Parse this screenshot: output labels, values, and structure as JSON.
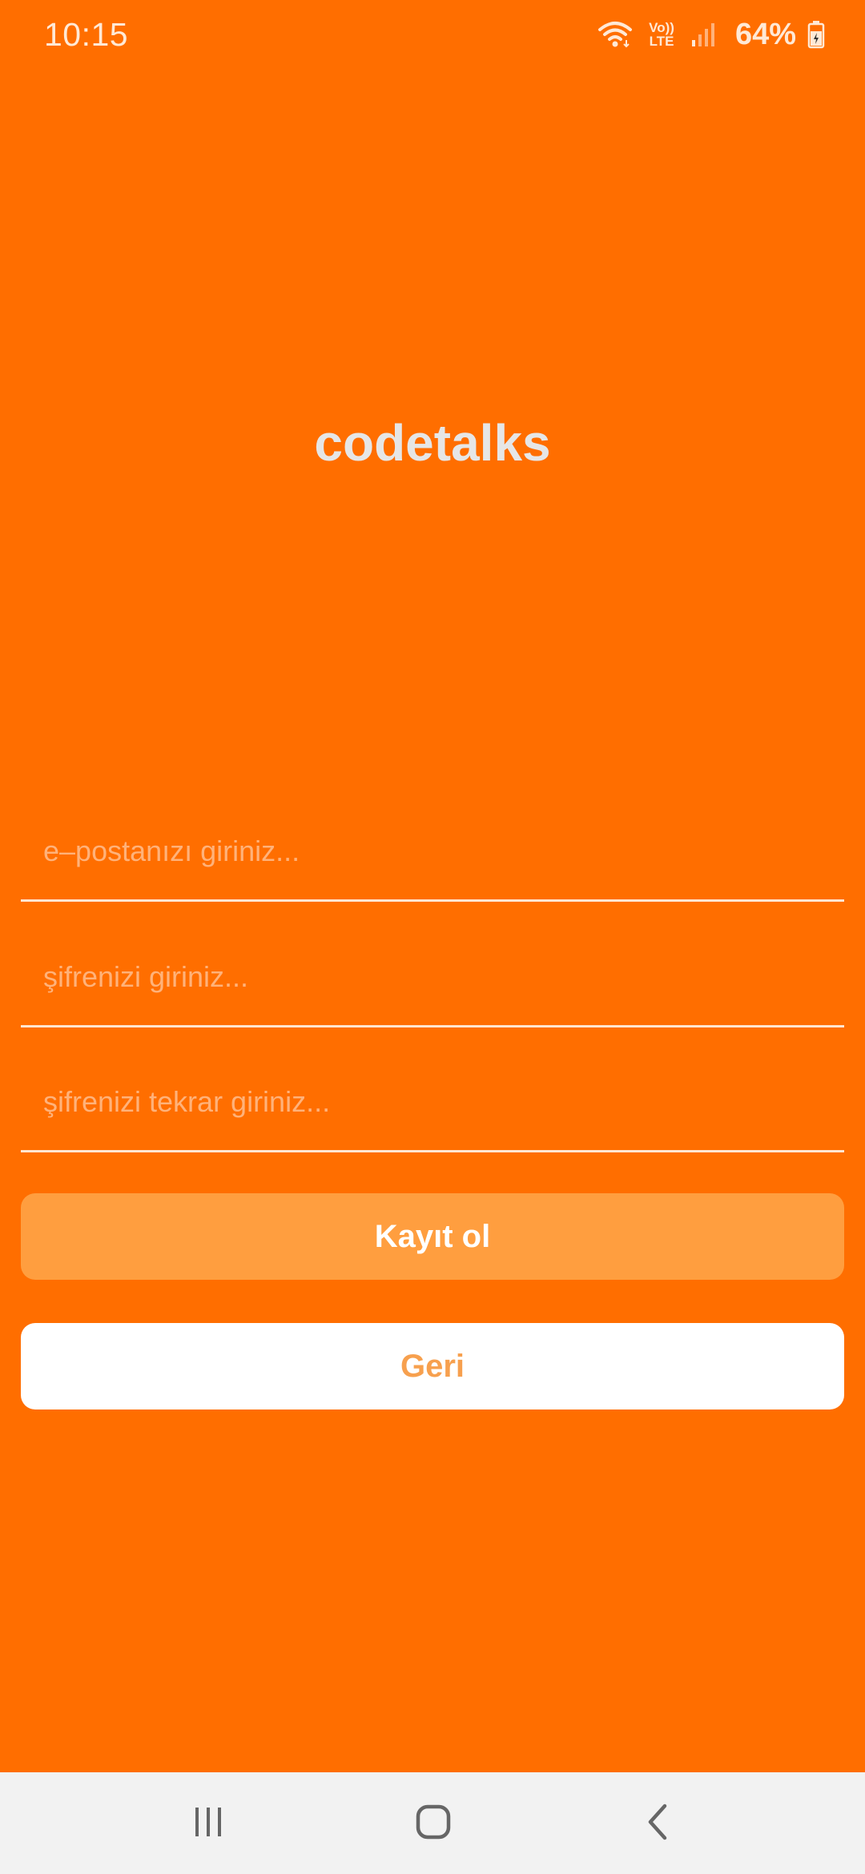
{
  "status_bar": {
    "time": "10:15",
    "volte_top": "Vo))",
    "volte_bottom": "LTE",
    "battery_percent": "64%",
    "icons": [
      "wifi-icon",
      "volte-icon",
      "signal-icon",
      "battery-icon"
    ]
  },
  "app": {
    "title": "codetalks"
  },
  "form": {
    "email_placeholder": "e–postanızı giriniz...",
    "password_placeholder": "şifrenizi giriniz...",
    "password_repeat_placeholder": "şifrenizi tekrar giriniz...",
    "register_label": "Kayıt ol",
    "back_label": "Geri"
  },
  "nav_bar": {
    "icons": [
      "recents-icon",
      "home-icon",
      "back-icon"
    ]
  },
  "colors": {
    "background": "#FF6E00",
    "register_button": "#FF9E3F",
    "back_button": "#FFFFFF",
    "back_button_text": "#F7A04E",
    "title": "#E6E6E6",
    "nav_bar": "#F2F2F2"
  }
}
